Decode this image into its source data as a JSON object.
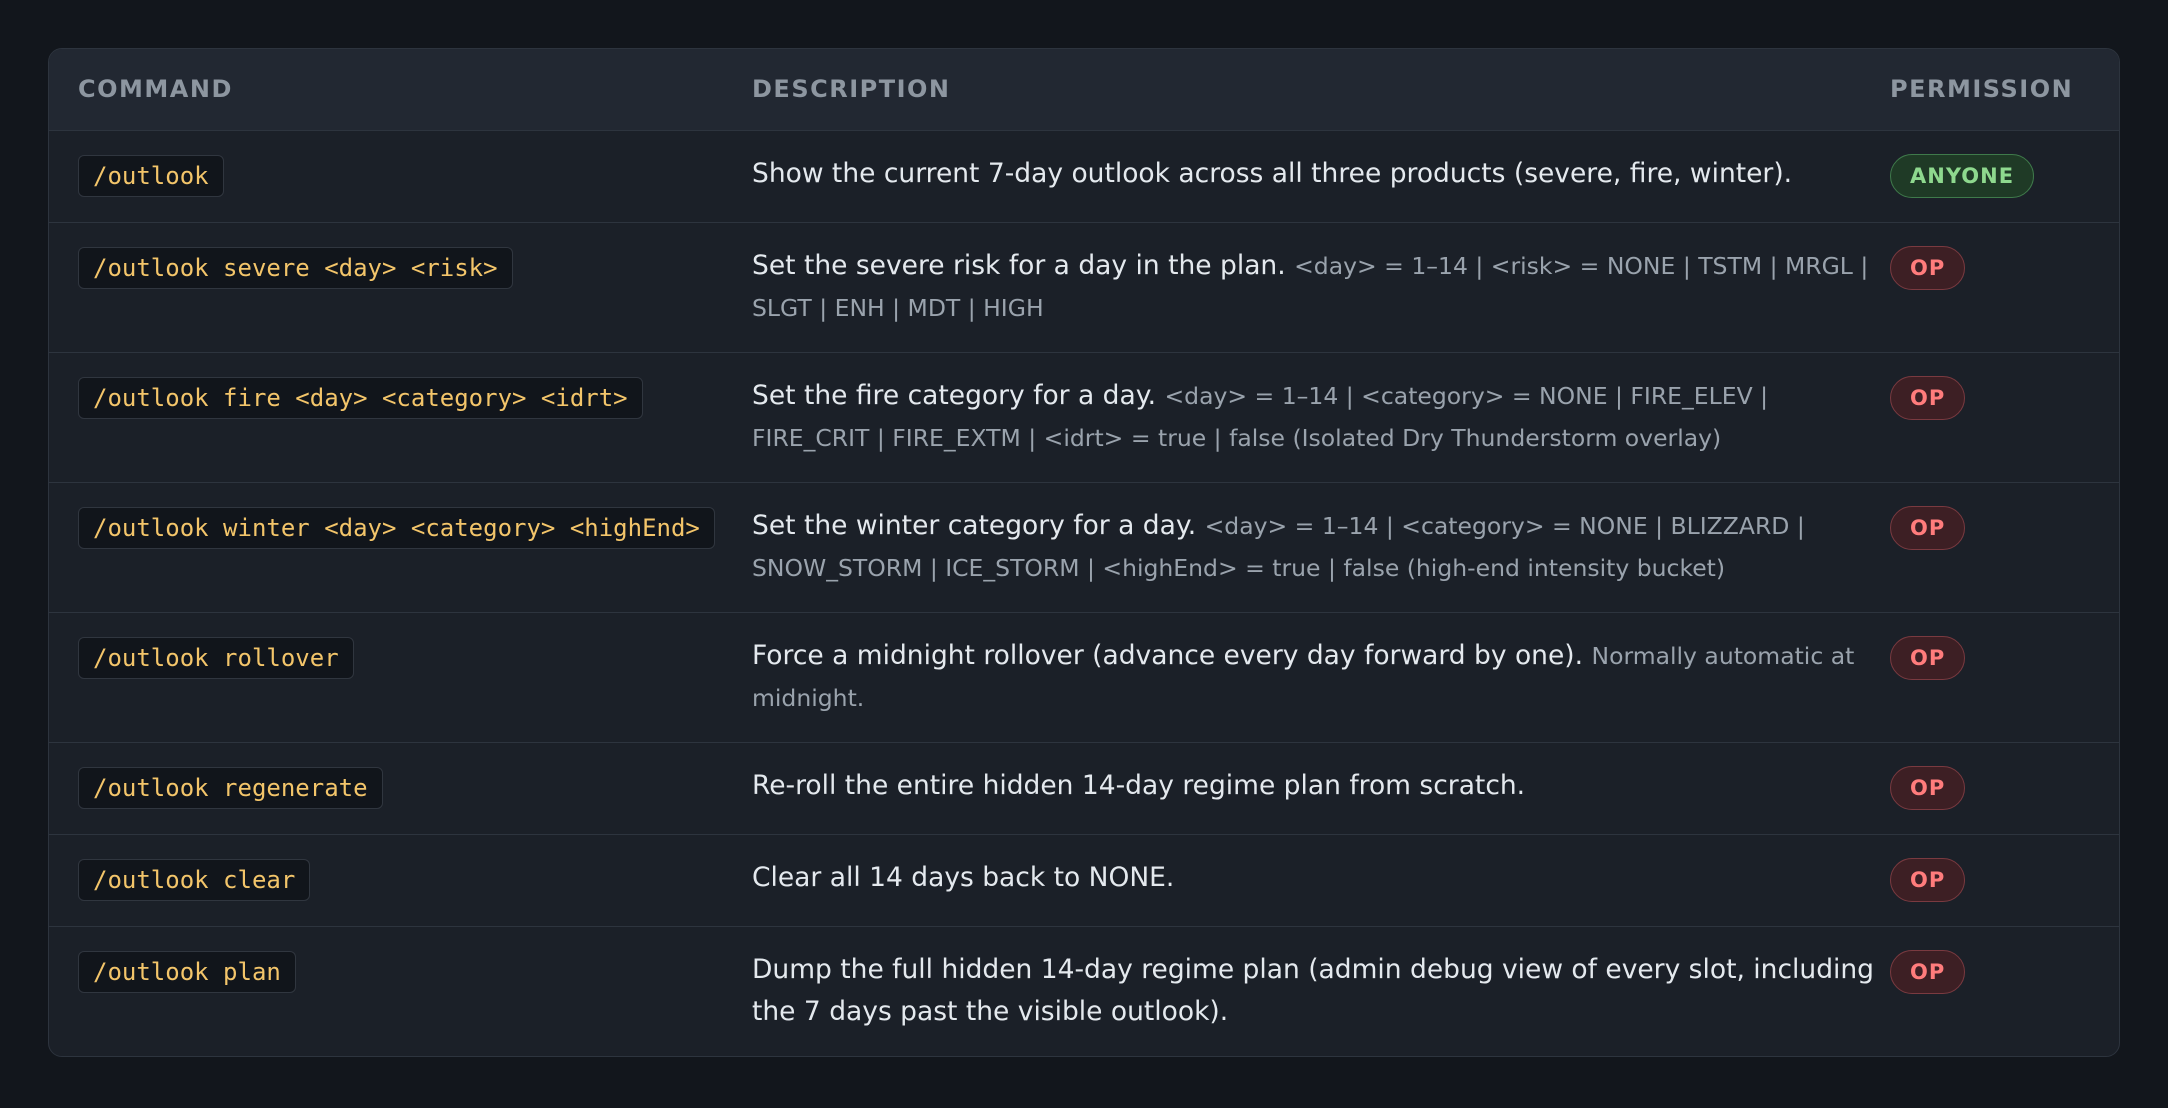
{
  "columns": {
    "command": "COMMAND",
    "description": "DESCRIPTION",
    "permission": "PERMISSION"
  },
  "colors": {
    "background": "#12161c",
    "card": "#1b2028",
    "command_text": "#f3c56a",
    "badge_anyone": "#8ed88e",
    "badge_op": "#ff7c7c"
  },
  "rows": [
    {
      "command": "/outlook",
      "description": "Show the current 7-day outlook across all three products (severe, fire, winter).",
      "note": "",
      "permission": "ANYONE",
      "permission_level": "anyone"
    },
    {
      "command": "/outlook severe <day> <risk>",
      "description": "Set the severe risk for a day in the plan.",
      "note": "<day> = 1–14 | <risk> = NONE | TSTM | MRGL | SLGT | ENH | MDT | HIGH",
      "permission": "OP",
      "permission_level": "op"
    },
    {
      "command": "/outlook fire <day> <category> <idrt>",
      "description": "Set the fire category for a day.",
      "note": "<day> = 1–14 | <category> = NONE | FIRE_ELEV | FIRE_CRIT | FIRE_EXTM | <idrt> = true | false (Isolated Dry Thunderstorm overlay)",
      "permission": "OP",
      "permission_level": "op"
    },
    {
      "command": "/outlook winter <day> <category> <highEnd>",
      "description": "Set the winter category for a day.",
      "note": "<day> = 1–14 | <category> = NONE | BLIZZARD | SNOW_STORM | ICE_STORM | <highEnd> = true | false (high-end intensity bucket)",
      "permission": "OP",
      "permission_level": "op"
    },
    {
      "command": "/outlook rollover",
      "description": "Force a midnight rollover (advance every day forward by one).",
      "note": "Normally automatic at midnight.",
      "permission": "OP",
      "permission_level": "op"
    },
    {
      "command": "/outlook regenerate",
      "description": "Re-roll the entire hidden 14-day regime plan from scratch.",
      "note": "",
      "permission": "OP",
      "permission_level": "op"
    },
    {
      "command": "/outlook clear",
      "description": "Clear all 14 days back to NONE.",
      "note": "",
      "permission": "OP",
      "permission_level": "op"
    },
    {
      "command": "/outlook plan",
      "description": "Dump the full hidden 14-day regime plan (admin debug view of every slot, including the 7 days past the visible outlook).",
      "note": "",
      "permission": "OP",
      "permission_level": "op"
    }
  ]
}
